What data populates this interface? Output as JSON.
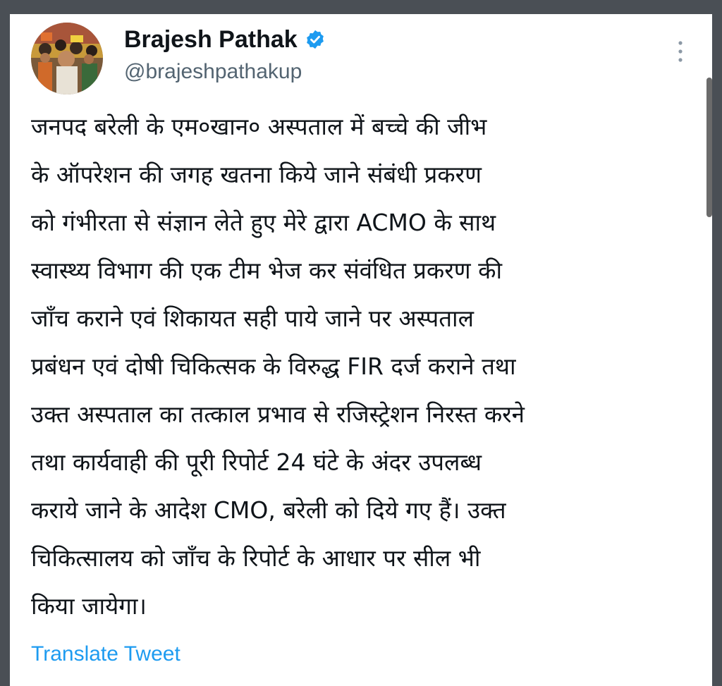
{
  "author": {
    "display_name": "Brajesh Pathak",
    "handle": "@brajeshpathakup",
    "verified": true,
    "avatar_icon": "profile-photo-crowd"
  },
  "tweet": {
    "lines": [
      "जनपद बरेली के एम०खान० अस्पताल में बच्चे की जीभ",
      "के ऑपरेशन की जगह खतना किये जाने संबंधी प्रकरण",
      "को गंभीरता से संज्ञान लेते हुए मेरे द्वारा ACMO के साथ",
      "स्वास्थ्य विभाग की एक टीम भेज कर संवंधित प्रकरण की",
      "जाँच कराने एवं शिकायत सही पाये जाने पर अस्पताल",
      "प्रबंधन एवं दोषी चिकित्सक के विरुद्ध FIR दर्ज कराने तथा",
      "उक्त अस्पताल का तत्काल प्रभाव से रजिस्ट्रेशन निरस्त करने",
      "तथा कार्यवाही की पूरी रिपोर्ट 24 घंटे के अंदर उपलब्ध",
      "कराये जाने के आदेश CMO, बरेली को दिये गए हैं। उक्त",
      "चिकित्सालय को जाँच के रिपोर्ट के आधार पर सील भी",
      "किया जायेगा।"
    ]
  },
  "actions": {
    "translate_label": "Translate Tweet",
    "more_icon": "more-vertical-icon"
  },
  "colors": {
    "frame_bg": "#4a4f55",
    "card_bg": "#ffffff",
    "text": "#0f1419",
    "secondary": "#536471",
    "link": "#1d9bf0",
    "verified": "#1d9bf0"
  }
}
